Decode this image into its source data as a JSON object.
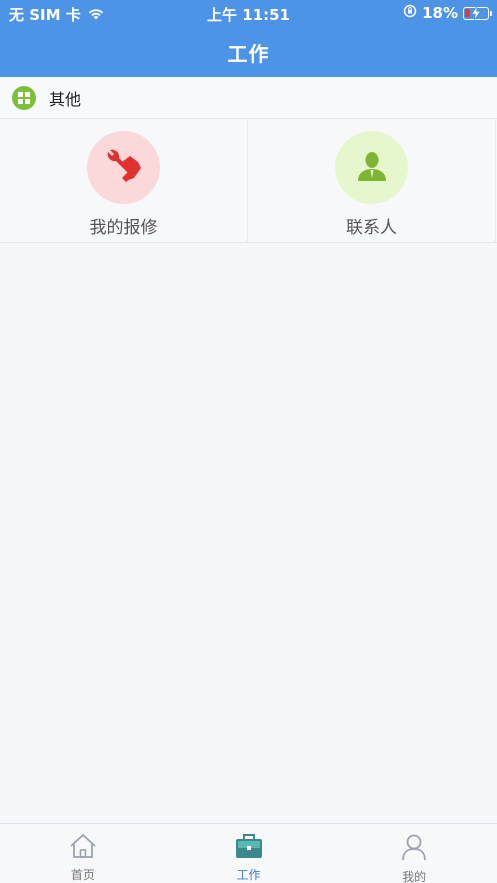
{
  "status_bar": {
    "carrier": "无 SIM 卡",
    "time": "上午 11:51",
    "battery": "18%"
  },
  "header": {
    "title": "工作"
  },
  "section": {
    "label": "其他"
  },
  "grid": [
    {
      "label": "我的报修",
      "icon": "wrench-handshake-icon",
      "bg": "#fbd9da",
      "color": "#e03131"
    },
    {
      "label": "联系人",
      "icon": "person-icon",
      "bg": "#e6f7cd",
      "color": "#7fb334"
    }
  ],
  "tabs": [
    {
      "label": "首页",
      "icon": "home-icon",
      "active": false
    },
    {
      "label": "工作",
      "icon": "briefcase-icon",
      "active": true
    },
    {
      "label": "我的",
      "icon": "user-icon",
      "active": false
    }
  ],
  "colors": {
    "header": "#4d93e6",
    "section_icon": "#7dbf3b",
    "active_tab": "#3d7fd6"
  }
}
